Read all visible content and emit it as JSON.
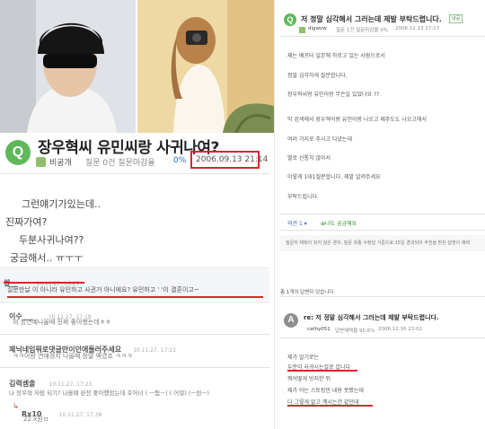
{
  "left_post": {
    "title": "장우혁씨 유민씨랑 사귀나여?",
    "meta": {
      "privacy": "비공개",
      "stats": "질문 0건 질문마감율",
      "rate": "0%",
      "datetime": "2006.09.13 21:14"
    },
    "body_lines": [
      "그런얘기가있는데..",
      "진짜가여?",
      "두분사귀나여??",
      "궁금해서.. ㅠㅜㅜ"
    ],
    "comments": [
      {
        "name": "쌀__",
        "date": "10.11.27. 16:27",
        "text": "질문한날      이 아니라 유민하고 사귄거 아니에요? 유민하고 ' '이 결혼이고~"
      },
      {
        "name": "이수___",
        "date": "10.11.27. 17:18",
        "text": "혀 성연예나올때 진짜 좋아했는데ㅎㅎ"
      },
      {
        "name": "제닉네임뭐로댓글만이던에들러주세요",
        "date": "10.11.27. 17:22",
        "text": "ㅋㅋ이랑 연애경지 나올때 정말 액겼죠 ㅋㅋㅋ"
      },
      {
        "name": "김력셈출",
        "date": "10.11.27. 17:23",
        "text": "나 장우혁 처럼 되기? 나올때 완전 좋아했었는데 호어녀 ( ㅡ됨ㅡ) ( 어헐) (ㅡ원ㅡ)"
      },
      {
        "name": "Rx10",
        "date": "10.11.27. 17:38",
        "text": "22 x원ㅁ"
      }
    ]
  },
  "right_question": {
    "title": "저 정말 심각해서 그러는데 제발 부탁드렵니다.",
    "tag": "내공",
    "user": "digwow",
    "meta": "질문 1건 질문마감율 0%",
    "date": "2006.12.13 17:17",
    "lines": [
      "제는 베프터 일본에 하로고 있는 사람으로서",
      "정말 심각하게 질문합니다.",
      "장우혁씨랑 유민이랑 무슨일 있었나요 ??",
      "막 검색에서 장우혁이랑 유민이랑 나오고 제주도도 나오고해서",
      "여러 가지로 추시고 다녔는데",
      "별로 신통치 않아서",
      "이렇게 1대1질문합니다. 제발 알려주세요",
      "부탁드립니다."
    ],
    "actions": {
      "opinion": "의견 1 ▾",
      "curious": "나도 궁금해요"
    },
    "notice": "질문자 채택이 되지 않은 경우, 질문 최종 수정일 기준으로 15일 경과되어 추천을 받은 답변이 채택"
  },
  "right_answer": {
    "count_label": "총 1개의 답변이 있습니다.",
    "title": "re: 저 정말 심각해서 그러는데 제발 부탁드렵니다.",
    "user": "cathy051",
    "meta": "답변채택율 95.6%",
    "date": "2006.12.16 23:02",
    "lines": [
      "제가 알기로는",
      "두분이 사귀시는걸로 압니다",
      "뭐어떻게 방지한 뒤",
      "제가 아는 스토킹만 내용 못봤는데",
      "다 그렇게 알고 계시는건 같던데"
    ]
  }
}
